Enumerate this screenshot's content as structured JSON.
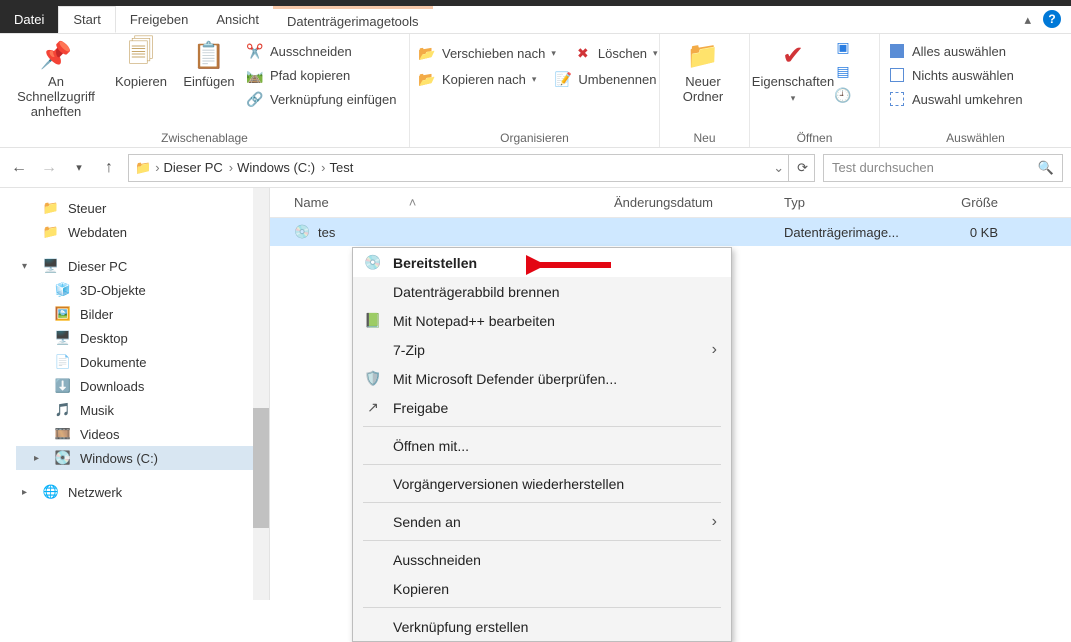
{
  "tabs": {
    "datei": "Datei",
    "start": "Start",
    "freigeben": "Freigeben",
    "ansicht": "Ansicht",
    "tool": "Datenträgerimagetools"
  },
  "ribbon": {
    "clipboard": {
      "pin": "An Schnellzugriff anheften",
      "copy": "Kopieren",
      "paste": "Einfügen",
      "cut": "Ausschneiden",
      "copypath": "Pfad kopieren",
      "pastelink": "Verknüpfung einfügen",
      "label": "Zwischenablage"
    },
    "organize": {
      "moveto": "Verschieben nach",
      "copyto": "Kopieren nach",
      "delete": "Löschen",
      "rename": "Umbenennen",
      "label": "Organisieren"
    },
    "new": {
      "newfolder": "Neuer Ordner",
      "label": "Neu"
    },
    "open": {
      "props": "Eigenschaften",
      "label": "Öffnen"
    },
    "select": {
      "all": "Alles auswählen",
      "none": "Nichts auswählen",
      "invert": "Auswahl umkehren",
      "label": "Auswählen"
    }
  },
  "breadcrumb": {
    "pc": "Dieser PC",
    "drive": "Windows  (C:)",
    "folder": "Test"
  },
  "search": {
    "placeholder": "Test durchsuchen"
  },
  "sidebar": {
    "items": [
      "Steuer",
      "Webdaten",
      "Dieser PC",
      "3D-Objekte",
      "Bilder",
      "Desktop",
      "Dokumente",
      "Downloads",
      "Musik",
      "Videos",
      "Windows  (C:)",
      "Netzwerk"
    ]
  },
  "columns": {
    "name": "Name",
    "date": "Änderungsdatum",
    "type": "Typ",
    "size": "Größe"
  },
  "file": {
    "name": "tes",
    "type": "Datenträgerimage...",
    "size": "0 KB"
  },
  "ctx": {
    "mount": "Bereitstellen",
    "burn": "Datenträgerabbild brennen",
    "npp": "Mit Notepad++ bearbeiten",
    "zip": "7-Zip",
    "defender": "Mit Microsoft Defender überprüfen...",
    "share": "Freigabe",
    "openwith": "Öffnen mit...",
    "prev": "Vorgängerversionen wiederherstellen",
    "sendto": "Senden an",
    "cut": "Ausschneiden",
    "copy": "Kopieren",
    "shortcut": "Verknüpfung erstellen"
  }
}
